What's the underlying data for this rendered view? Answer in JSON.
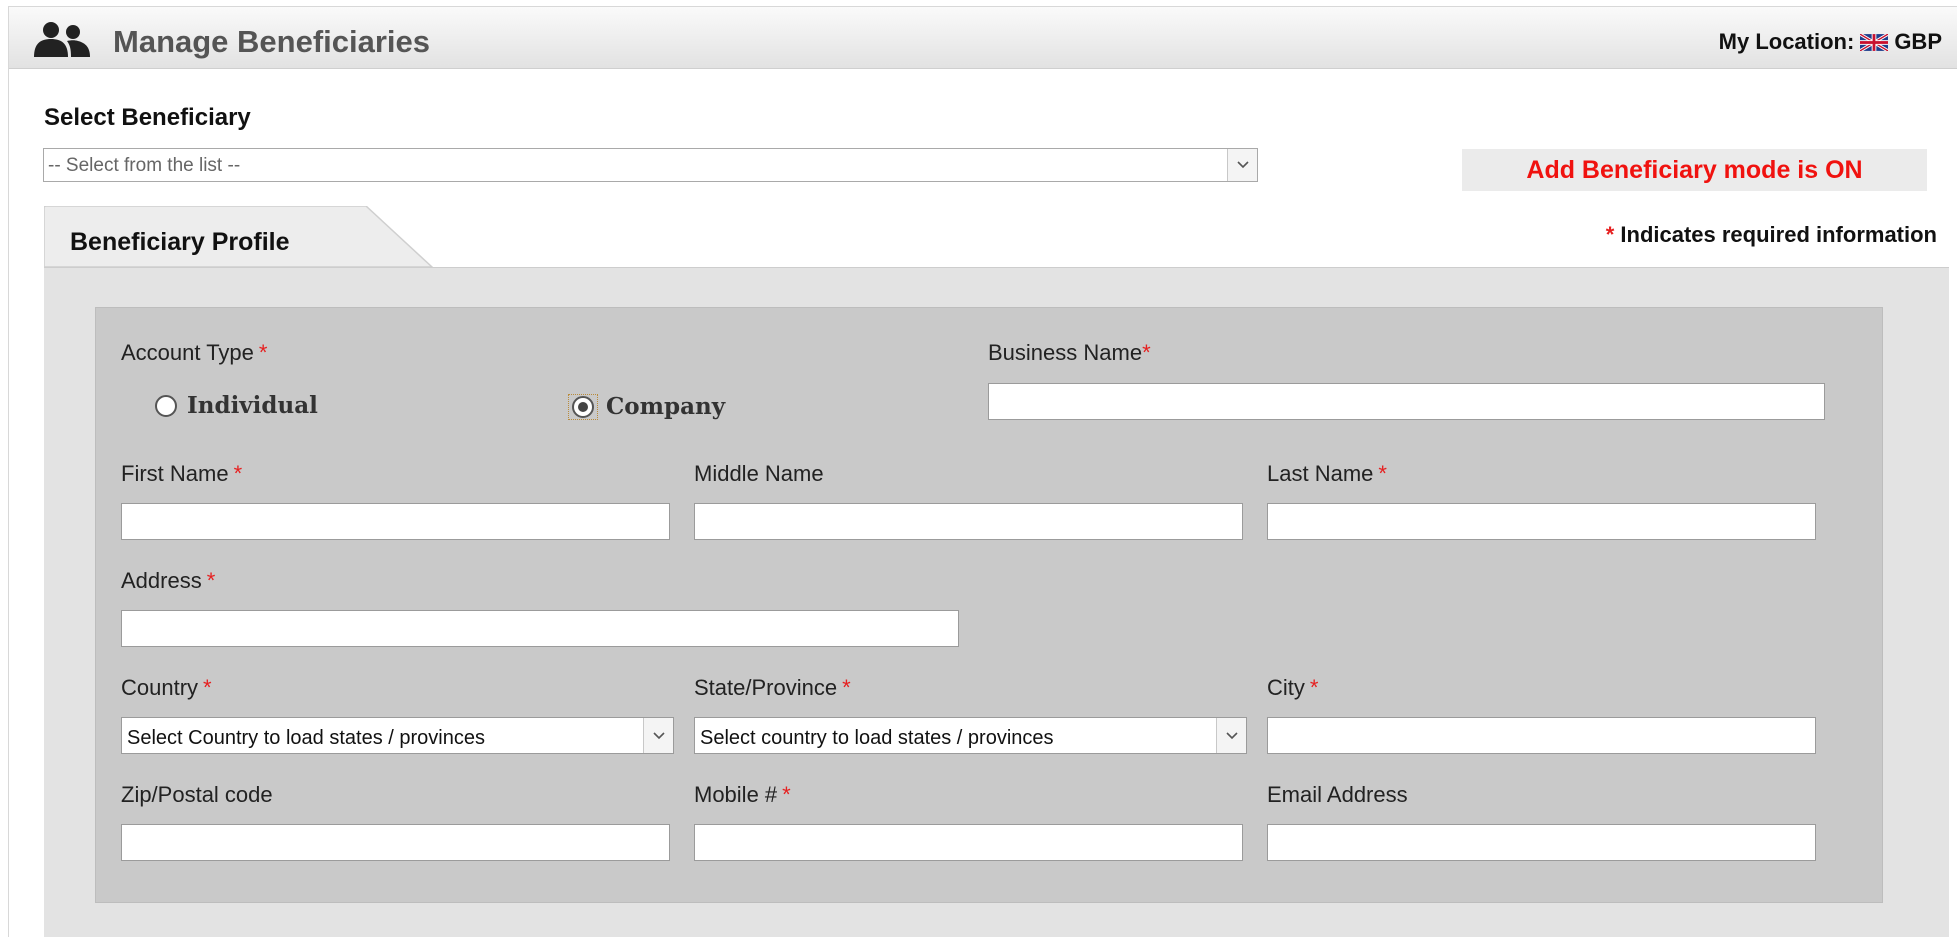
{
  "header": {
    "title": "Manage Beneficiaries",
    "location_label": "My Location:",
    "currency": "GBP"
  },
  "select_beneficiary": {
    "label": "Select Beneficiary",
    "value": "-- Select from the list --"
  },
  "mode_badge": "Add Beneficiary mode is ON",
  "tab": {
    "label": "Beneficiary Profile"
  },
  "required_note": {
    "star": "*",
    "text": "Indicates required information"
  },
  "form": {
    "account_type": {
      "label": "Account Type",
      "options": [
        "Individual",
        "Company"
      ],
      "selected": "Company"
    },
    "business_name": {
      "label": "Business Name",
      "value": ""
    },
    "first_name": {
      "label": "First Name",
      "value": ""
    },
    "middle_name": {
      "label": "Middle Name",
      "value": ""
    },
    "last_name": {
      "label": "Last Name",
      "value": ""
    },
    "address": {
      "label": "Address",
      "value": ""
    },
    "country": {
      "label": "Country",
      "value": "Select Country to load states / provinces"
    },
    "state": {
      "label": "State/Province",
      "value": "Select country to load states / provinces"
    },
    "city": {
      "label": "City",
      "value": ""
    },
    "zip": {
      "label": "Zip/Postal code",
      "value": ""
    },
    "mobile": {
      "label": "Mobile #",
      "value": ""
    },
    "email": {
      "label": "Email Address",
      "value": ""
    }
  },
  "icons": {
    "header": "users-icon",
    "flag": "uk-flag-icon",
    "dropdown": "chevron-down-icon"
  },
  "colors": {
    "required": "#e62020",
    "mode_badge_text": "#f0120f"
  }
}
